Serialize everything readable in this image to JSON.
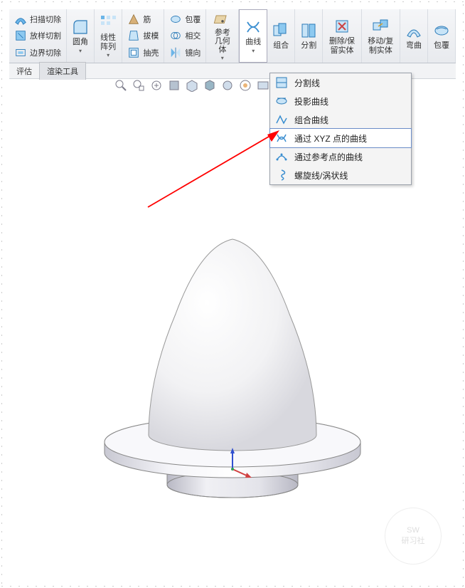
{
  "ribbon": {
    "g1": {
      "a": "扫描切除",
      "b": "放样切割",
      "c": "边界切除"
    },
    "g2": {
      "a": "圆角",
      "b": "线性阵列"
    },
    "g3": {
      "a": "筋",
      "b": "拔模",
      "c": "抽壳"
    },
    "g4": {
      "a": "包覆",
      "b": "相交",
      "c": "镜向"
    },
    "g5": "参考几何体",
    "g6": "曲线",
    "g7": {
      "a": "组合",
      "b": "分割",
      "c": "删除/保留实体",
      "d": "移动/复制实体",
      "e": "弯曲",
      "f": "包覆"
    }
  },
  "tabs": {
    "a": "评估",
    "b": "渲染工具"
  },
  "menu": {
    "a": "分割线",
    "b": "投影曲线",
    "c": "组合曲线",
    "d": "通过 XYZ 点的曲线",
    "e": "通过参考点的曲线",
    "f": "螺旋线/涡状线"
  },
  "watermark": {
    "a": "SW",
    "b": "研习社"
  }
}
